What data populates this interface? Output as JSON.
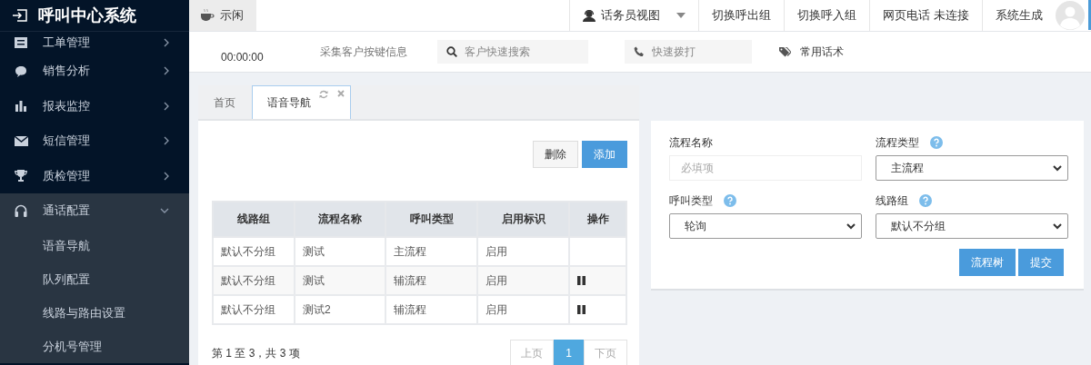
{
  "app": {
    "title": "呼叫中心系统"
  },
  "status": {
    "label": "示闲"
  },
  "topbar": {
    "view_menu": "话务员视图",
    "buttons": [
      "切换呼出组",
      "切换呼入组",
      "网页电话 未连接"
    ],
    "user": "系统生成"
  },
  "toolbar": {
    "timer": "00:00:00",
    "collect": "采集客户按键信息",
    "search": {
      "placeholder": "客户快速搜索"
    },
    "dial": {
      "placeholder": "快速拨打"
    },
    "scripts": "常用话术"
  },
  "sidebar": {
    "items": [
      {
        "label": "工单管理",
        "expanded": false
      },
      {
        "label": "销售分析",
        "expanded": false
      },
      {
        "label": "报表监控",
        "expanded": false
      },
      {
        "label": "短信管理",
        "expanded": false
      },
      {
        "label": "质检管理",
        "expanded": false
      },
      {
        "label": "通话配置",
        "expanded": true,
        "children": [
          {
            "label": "语音导航"
          },
          {
            "label": "队列配置"
          },
          {
            "label": "线路与路由设置"
          },
          {
            "label": "分机号管理"
          }
        ]
      }
    ]
  },
  "tabs": [
    {
      "label": "首页",
      "selected": false
    },
    {
      "label": "语音导航",
      "selected": true
    }
  ],
  "actions": [
    {
      "label": "删除",
      "kind": "default"
    },
    {
      "label": "添加",
      "kind": "primary"
    }
  ],
  "table": {
    "columns": [
      "线路组",
      "流程名称",
      "呼叫类型",
      "启用标识",
      "操作"
    ],
    "rows": [
      {
        "cells": [
          "默认不分组",
          "测试",
          "主流程",
          "启用"
        ],
        "pause_button": false
      },
      {
        "cells": [
          "默认不分组",
          "测试",
          "辅流程",
          "启用"
        ],
        "pause_button": true
      },
      {
        "cells": [
          "默认不分组",
          "测试2",
          "辅流程",
          "启用"
        ],
        "pause_button": true
      }
    ]
  },
  "pagination": {
    "summary": "第 1 至 3，共 3 项",
    "prev": {
      "label": "上页",
      "disabled": true
    },
    "pages": [
      {
        "label": "1",
        "selected": true
      }
    ],
    "next": {
      "label": "下页",
      "disabled": true
    }
  },
  "form": {
    "fields": [
      {
        "label": "流程名称",
        "kind": "text",
        "placeholder": "必填项",
        "help": false
      },
      {
        "label": "流程类型",
        "kind": "select",
        "value": "主流程",
        "help": true
      },
      {
        "label": "呼叫类型",
        "kind": "select",
        "value": "轮询",
        "help": true
      },
      {
        "label": "线路组",
        "kind": "select",
        "value": "默认不分组",
        "help": true
      }
    ],
    "buttons": [
      "流程树",
      "提交"
    ]
  }
}
